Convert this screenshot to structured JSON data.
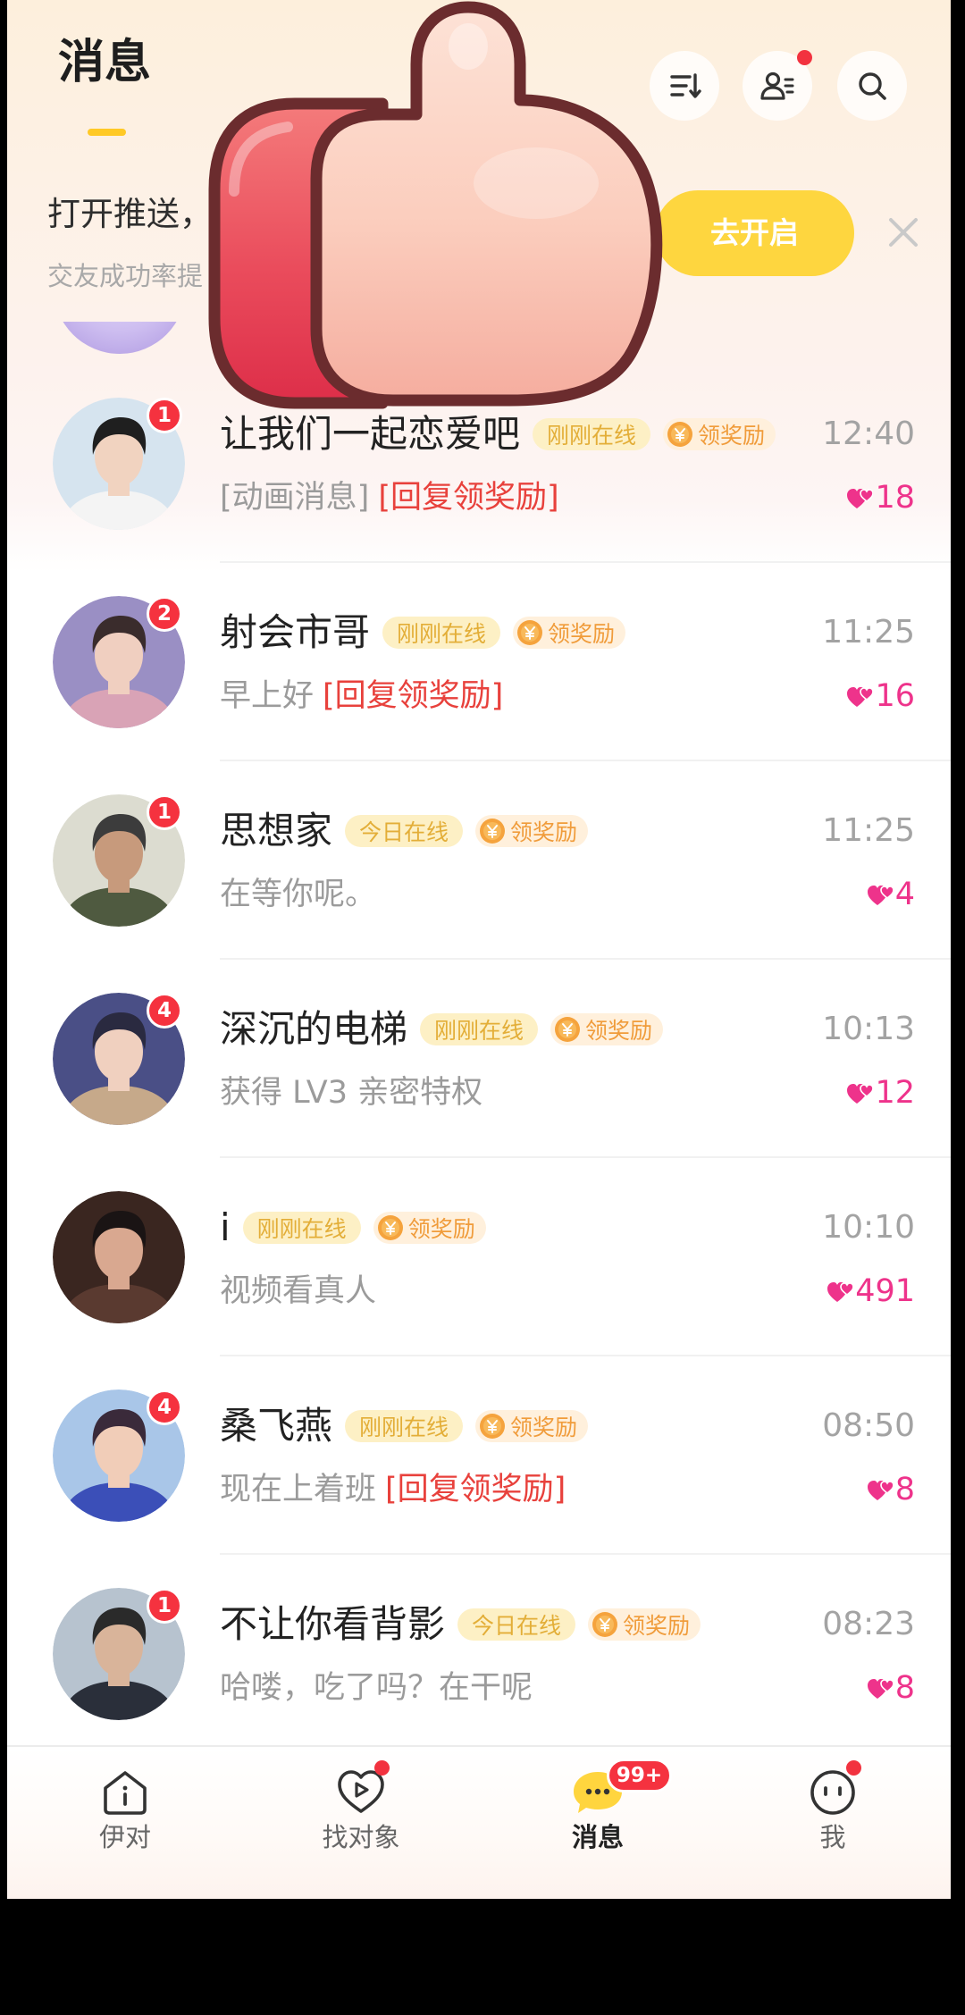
{
  "header": {
    "title": "消息",
    "icons": [
      "sort-icon",
      "contacts-icon",
      "search-icon"
    ]
  },
  "banner": {
    "title": "打开推送，",
    "subtitle": "交友成功率提",
    "button": "去开启",
    "close_icon": "close-icon"
  },
  "colors": {
    "accent": "#fed63f",
    "badge": "#f5323f",
    "heart": "#ee338b",
    "highlight": "#e8413c",
    "status_tag": "#e3ae38"
  },
  "chats": {
    "items": [
      {
        "name": "让我们一起恋爱吧",
        "status": "刚刚在线",
        "reward": "领奖励",
        "time": "12:40",
        "message": "[动画消息]",
        "highlight": "[回复领奖励]",
        "hearts": "18",
        "badge": "1",
        "avatar": {
          "bg": "#d6e4ef",
          "hair": "#1f1f1f",
          "shirt": "#f4f4f4",
          "skin": "#f1d3c0"
        }
      },
      {
        "name": "射会市哥",
        "status": "刚刚在线",
        "reward": "领奖励",
        "time": "11:25",
        "message": "早上好",
        "highlight": "[回复领奖励]",
        "hearts": "16",
        "badge": "2",
        "avatar": {
          "bg": "#9a8fc4",
          "hair": "#3a2c2c",
          "shirt": "#d9a3b6",
          "skin": "#f0cfc0"
        }
      },
      {
        "name": "思想家",
        "status": "今日在线",
        "reward": "领奖励",
        "time": "11:25",
        "message": "在等你呢。",
        "hearts": "4",
        "badge": "1",
        "avatar": {
          "bg": "#dcdcd0",
          "hair": "#3c3c3c",
          "shirt": "#4f5a40",
          "skin": "#c79a7c"
        }
      },
      {
        "name": "深沉的电梯",
        "status": "刚刚在线",
        "reward": "领奖励",
        "time": "10:13",
        "message": "获得 LV3 亲密特权",
        "hearts": "12",
        "badge": "4",
        "avatar": {
          "bg": "#4a4f86",
          "hair": "#2a2a40",
          "shirt": "#c6a98a",
          "skin": "#f0d0bf"
        }
      },
      {
        "name": "i",
        "status": "刚刚在线",
        "reward": "领奖励",
        "time": "10:10",
        "message": "视频看真人",
        "hearts": "491",
        "avatar": {
          "bg": "#3a2620",
          "hair": "#1a1414",
          "shirt": "#5a3a30",
          "skin": "#d9a890"
        }
      },
      {
        "name": "桑飞燕",
        "status": "刚刚在线",
        "reward": "领奖励",
        "time": "08:50",
        "message": "现在上着班",
        "highlight": "[回复领奖励]",
        "hearts": "8",
        "badge": "4",
        "avatar": {
          "bg": "#a9c6e8",
          "hair": "#3a2a3a",
          "shirt": "#3b4fb8",
          "skin": "#f1cdb8"
        }
      },
      {
        "name": "不让你看背影",
        "status": "今日在线",
        "reward": "领奖励",
        "time": "08:23",
        "message": "哈喽，吃了吗？在干呢",
        "hearts": "8",
        "badge": "1",
        "avatar": {
          "bg": "#b7c3cf",
          "hair": "#2a2a2a",
          "shirt": "#2a2f3a",
          "skin": "#d9b49a"
        }
      }
    ]
  },
  "nav": {
    "items": [
      {
        "label": "伊对",
        "icon": "home-icon"
      },
      {
        "label": "找对象",
        "icon": "heart-play-icon"
      },
      {
        "label": "消息",
        "icon": "chat-bubble-icon",
        "badge": "99+"
      },
      {
        "label": "我",
        "icon": "face-icon"
      }
    ]
  }
}
